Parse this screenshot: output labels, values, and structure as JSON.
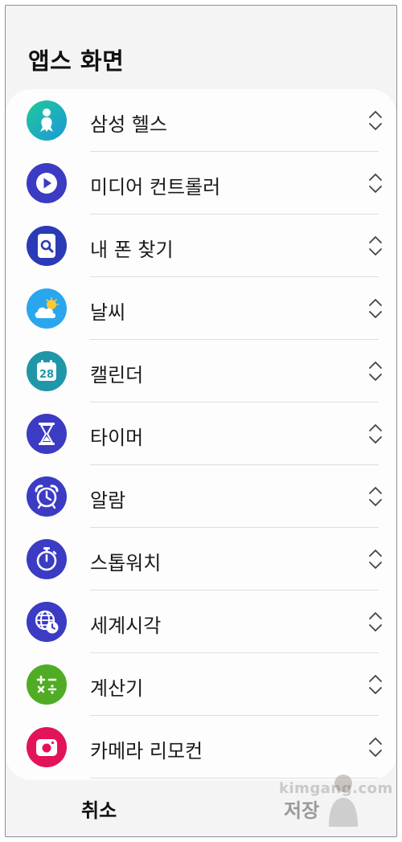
{
  "header": {
    "title": "앱스 화면"
  },
  "apps": [
    {
      "label": "삼성 헬스",
      "icon": "samsung-health-icon",
      "color": "#1fb3c9"
    },
    {
      "label": "미디어 컨트롤러",
      "icon": "play-icon",
      "color": "#3b3bc4"
    },
    {
      "label": "내 폰 찾기",
      "icon": "magnifier-icon",
      "color": "#2b3ab6"
    },
    {
      "label": "날씨",
      "icon": "weather-icon",
      "color": "#2aa6ee"
    },
    {
      "label": "캘린더",
      "icon": "calendar-icon",
      "color": "#1f97a8",
      "badge": "28"
    },
    {
      "label": "타이머",
      "icon": "hourglass-icon",
      "color": "#3b3bc4"
    },
    {
      "label": "알람",
      "icon": "alarm-clock-icon",
      "color": "#3b3bc4"
    },
    {
      "label": "스톱워치",
      "icon": "stopwatch-icon",
      "color": "#3b3bc4"
    },
    {
      "label": "세계시각",
      "icon": "globe-clock-icon",
      "color": "#3b3bc4"
    },
    {
      "label": "계산기",
      "icon": "calculator-icon",
      "color": "#4fac24"
    },
    {
      "label": "카메라 리모컨",
      "icon": "camera-icon",
      "color": "#e2135a"
    }
  ],
  "reorder_icon": "reorder-chevrons-icon",
  "footer": {
    "cancel_label": "취소",
    "save_label": "저장"
  },
  "watermark": "kimgang.com"
}
